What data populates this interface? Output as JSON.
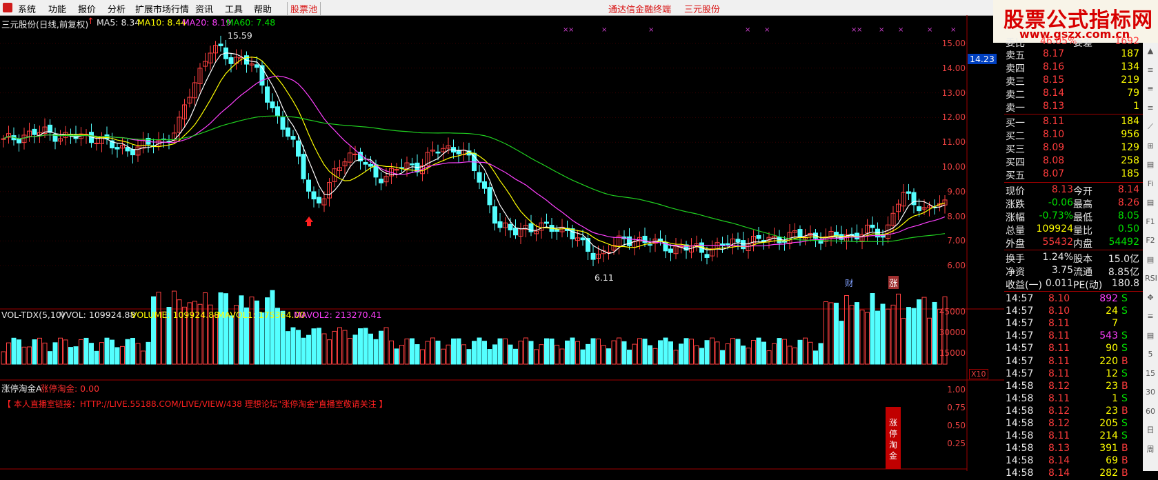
{
  "menu": {
    "items": [
      "系统",
      "功能",
      "报价",
      "分析",
      "扩展市场行情",
      "资讯",
      "工具",
      "帮助"
    ],
    "stock_pool": "股票池",
    "center_left": "通达信金融终端",
    "center_right": "三元股份"
  },
  "logo": {
    "line1": "股票公式指标网",
    "line2": "www.gszx.com.cn"
  },
  "price_panel": {
    "title": "三元股份(日线,前复权)",
    "ma5": "MA5: 8.34",
    "ma10": "MA10: 8.44",
    "ma20": "MA20: 8.19",
    "ma60": "MA60: 7.48",
    "high_label": "15.59",
    "low_label": "6.11",
    "current_price_tag": "14.23",
    "badge_cai": "财",
    "badge_zhang": "涨",
    "y_ticks": [
      "15.00",
      "14.00",
      "13.00",
      "12.00",
      "11.00",
      "10.00",
      "9.00",
      "8.00",
      "7.00",
      "6.00"
    ]
  },
  "volume_panel": {
    "title": "VOL-TDX(5,10)",
    "vvol": "VVOL: 109924.88",
    "volume": "VOLUME: 109924.88",
    "mavol1": "MAVOL1: 175364.00",
    "mavol2": "MAVOL2: 213270.41",
    "y_ticks": [
      "45000",
      "30000",
      "15000"
    ],
    "unit": "X10"
  },
  "indicator_panel": {
    "name": "涨停淘金A",
    "sub": "涨停淘金: 0.00",
    "notice": "【 本人直播室链接：HTTP://LIVE.55188.COM/LIVE/VIEW/438 理想论坛\"涨停淘金\"直播室敬请关注 】",
    "signal_text": [
      "涨",
      "停",
      "淘",
      "金"
    ],
    "y_ticks": [
      "1.00",
      "0.75",
      "0.50",
      "0.25"
    ]
  },
  "quote": {
    "header": {
      "c1": "委比",
      "c2": "46.05%",
      "c3": "委差",
      "c4": "1692"
    },
    "asks": [
      {
        "label": "卖五",
        "price": "8.17",
        "vol": "187"
      },
      {
        "label": "卖四",
        "price": "8.16",
        "vol": "134"
      },
      {
        "label": "卖三",
        "price": "8.15",
        "vol": "219"
      },
      {
        "label": "卖二",
        "price": "8.14",
        "vol": "79"
      },
      {
        "label": "卖一",
        "price": "8.13",
        "vol": "1"
      }
    ],
    "bids": [
      {
        "label": "买一",
        "price": "8.11",
        "vol": "184"
      },
      {
        "label": "买二",
        "price": "8.10",
        "vol": "956"
      },
      {
        "label": "买三",
        "price": "8.09",
        "vol": "129"
      },
      {
        "label": "买四",
        "price": "8.08",
        "vol": "258"
      },
      {
        "label": "买五",
        "price": "8.07",
        "vol": "185"
      }
    ],
    "stats": [
      {
        "l1": "现价",
        "v1": "8.13",
        "l2": "今开",
        "v2": "8.14"
      },
      {
        "l1": "涨跌",
        "v1": "-0.06",
        "l2": "最高",
        "v2": "8.26"
      },
      {
        "l1": "涨幅",
        "v1": "-0.73%",
        "l2": "最低",
        "v2": "8.05"
      },
      {
        "l1": "总量",
        "v1": "109924",
        "l2": "量比",
        "v2": "0.50"
      },
      {
        "l1": "外盘",
        "v1": "55432",
        "l2": "内盘",
        "v2": "54492"
      }
    ],
    "fund": [
      {
        "l1": "换手",
        "v1": "1.24%",
        "l2": "股本",
        "v2": "15.0亿"
      },
      {
        "l1": "净资",
        "v1": "3.75",
        "l2": "流通",
        "v2": "8.85亿"
      },
      {
        "l1": "收益(一)",
        "v1": "0.011",
        "l2": "PE(动)",
        "v2": "180.8"
      }
    ]
  },
  "ticks": [
    {
      "t": "14:57",
      "p": "8.10",
      "v": "892",
      "s": "S"
    },
    {
      "t": "14:57",
      "p": "8.10",
      "v": "24",
      "s": "S"
    },
    {
      "t": "14:57",
      "p": "8.11",
      "v": "7",
      "s": ""
    },
    {
      "t": "14:57",
      "p": "8.11",
      "v": "543",
      "s": "S"
    },
    {
      "t": "14:57",
      "p": "8.11",
      "v": "90",
      "s": "S"
    },
    {
      "t": "14:57",
      "p": "8.11",
      "v": "220",
      "s": "B"
    },
    {
      "t": "14:57",
      "p": "8.11",
      "v": "12",
      "s": "S"
    },
    {
      "t": "14:58",
      "p": "8.12",
      "v": "23",
      "s": "B"
    },
    {
      "t": "14:58",
      "p": "8.11",
      "v": "1",
      "s": "S"
    },
    {
      "t": "14:58",
      "p": "8.12",
      "v": "23",
      "s": "B"
    },
    {
      "t": "14:58",
      "p": "8.12",
      "v": "205",
      "s": "S"
    },
    {
      "t": "14:58",
      "p": "8.11",
      "v": "214",
      "s": "S"
    },
    {
      "t": "14:58",
      "p": "8.13",
      "v": "391",
      "s": "B"
    },
    {
      "t": "14:58",
      "p": "8.14",
      "v": "69",
      "s": "B"
    },
    {
      "t": "14:58",
      "p": "8.14",
      "v": "282",
      "s": "B"
    }
  ],
  "sidebar_icons": [
    "▲",
    "≡",
    "≡",
    "≡",
    "⟋",
    "⊞",
    "▤",
    "Fi",
    "▤",
    "F1",
    "F2",
    "▤",
    "RSI",
    "✥",
    "≡",
    "▤",
    "5",
    "15",
    "30",
    "60",
    "日",
    "周"
  ]
}
